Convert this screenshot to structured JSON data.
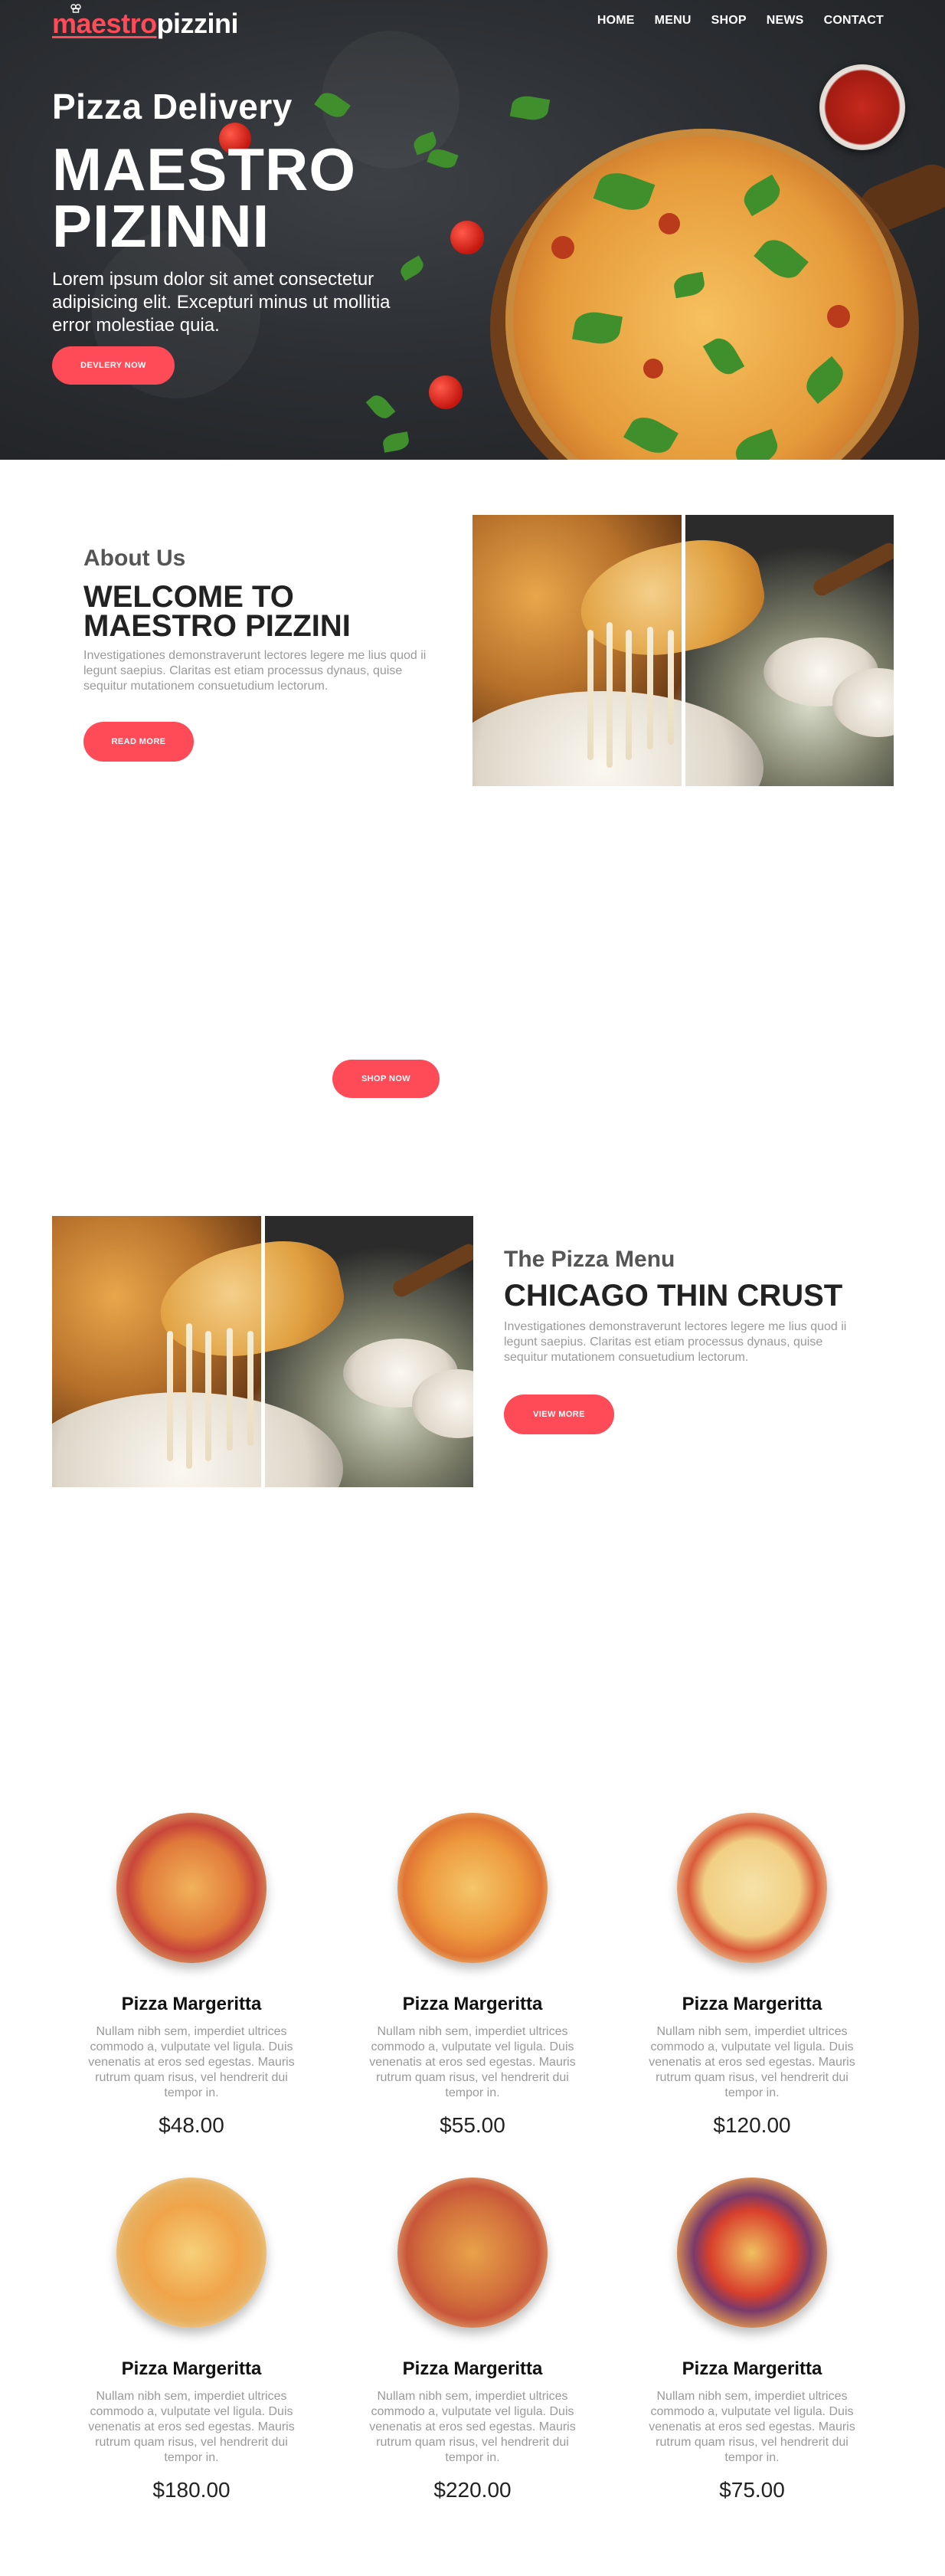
{
  "brand": {
    "part1": "maestro",
    "part2": "pizzini",
    "accent": "#ff4a57"
  },
  "nav": {
    "items": [
      "HOME",
      "MENU",
      "SHOP",
      "NEWS",
      "CONTACT"
    ]
  },
  "hero": {
    "subtitle": "Pizza Delivery",
    "title": "MAESTRO PIZINNI",
    "text": "Lorem ipsum dolor sit amet consectetur adipisicing elit. Excepturi minus ut mollitia error molestiae quia.",
    "button": "DEVLERY NOW"
  },
  "about": {
    "kicker": "About Us",
    "heading": "WELCOME TO MAESTRO PIZZINI",
    "text": "Investigationes demonstraverunt lectores legere me lius quod ii legunt saepius. Claritas est etiam processus dynaus, quise sequitur mutationem consuetudium lectorum.",
    "button": "READ MORE"
  },
  "shop": {
    "button": "SHOP NOW"
  },
  "menu": {
    "kicker": "The Pizza Menu",
    "heading": "CHICAGO THIN CRUST",
    "text": "Investigationes demonstraverunt lectores legere me lius quod ii legunt saepius. Claritas est etiam processus dynaus, quise sequitur mutationem consuetudium lectorum.",
    "button": "VIEW MORE"
  },
  "products": [
    {
      "name": "Pizza Margeritta",
      "desc": "Nullam nibh sem, imperdiet ultrices commodo a, vulputate vel ligula. Duis venenatis at eros sed egestas. Mauris rutrum quam risus, vel hendrerit dui tempor in.",
      "price": "$48.00"
    },
    {
      "name": "Pizza Margeritta",
      "desc": "Nullam nibh sem, imperdiet ultrices commodo a, vulputate vel ligula. Duis venenatis at eros sed egestas. Mauris rutrum quam risus, vel hendrerit dui tempor in.",
      "price": "$55.00"
    },
    {
      "name": "Pizza Margeritta",
      "desc": "Nullam nibh sem, imperdiet ultrices commodo a, vulputate vel ligula. Duis venenatis at eros sed egestas. Mauris rutrum quam risus, vel hendrerit dui tempor in.",
      "price": "$120.00"
    },
    {
      "name": "Pizza Margeritta",
      "desc": "Nullam nibh sem, imperdiet ultrices commodo a, vulputate vel ligula. Duis venenatis at eros sed egestas. Mauris rutrum quam risus, vel hendrerit dui tempor in.",
      "price": "$180.00"
    },
    {
      "name": "Pizza Margeritta",
      "desc": "Nullam nibh sem, imperdiet ultrices commodo a, vulputate vel ligula. Duis venenatis at eros sed egestas. Mauris rutrum quam risus, vel hendrerit dui tempor in.",
      "price": "$220.00"
    },
    {
      "name": "Pizza Margeritta",
      "desc": "Nullam nibh sem, imperdiet ultrices commodo a, vulputate vel ligula. Duis venenatis at eros sed egestas. Mauris rutrum quam risus, vel hendrerit dui tempor in.",
      "price": "$75.00"
    }
  ]
}
